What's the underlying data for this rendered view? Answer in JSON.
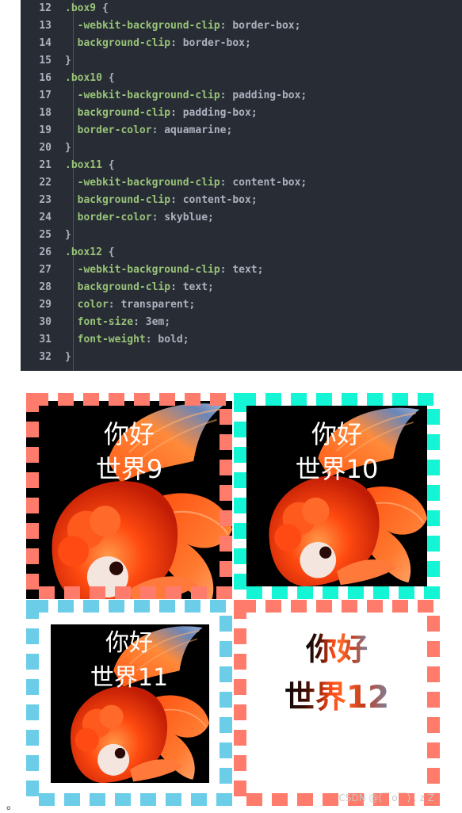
{
  "code": {
    "lines": [
      {
        "num": "12",
        "sel": ".box9",
        "rest": " {"
      },
      {
        "num": "13",
        "prop": "-webkit-background-clip",
        "val": "border-box"
      },
      {
        "num": "14",
        "prop": "background-clip",
        "val": "border-box"
      },
      {
        "num": "15",
        "close": "}"
      },
      {
        "num": "16",
        "sel": ".box10",
        "rest": " {"
      },
      {
        "num": "17",
        "prop": "-webkit-background-clip",
        "val": "padding-box"
      },
      {
        "num": "18",
        "prop": "background-clip",
        "val": "padding-box"
      },
      {
        "num": "19",
        "prop": "border-color",
        "val": "aquamarine"
      },
      {
        "num": "20",
        "close": "}"
      },
      {
        "num": "21",
        "sel": ".box11",
        "rest": " {"
      },
      {
        "num": "22",
        "prop": "-webkit-background-clip",
        "val": "content-box"
      },
      {
        "num": "23",
        "prop": "background-clip",
        "val": "content-box"
      },
      {
        "num": "24",
        "prop": "border-color",
        "val": "skyblue"
      },
      {
        "num": "25",
        "close": "}"
      },
      {
        "num": "26",
        "sel": ".box12",
        "rest": " {"
      },
      {
        "num": "27",
        "prop": "-webkit-background-clip",
        "val": "text"
      },
      {
        "num": "28",
        "prop": "background-clip",
        "val": "text"
      },
      {
        "num": "29",
        "prop": "color",
        "val": "transparent"
      },
      {
        "num": "30",
        "prop": "font-size",
        "val": "3em"
      },
      {
        "num": "31",
        "prop": "font-weight",
        "val": "bold"
      },
      {
        "num": "32",
        "close": "}"
      }
    ]
  },
  "boxes": {
    "box9": {
      "line1": "你好",
      "line2": "世界9"
    },
    "box10": {
      "line1": "你好",
      "line2": "世界10"
    },
    "box11": {
      "line1": "你好",
      "line2": "世界11"
    },
    "box12": {
      "line1": "你好",
      "line2": "世界12"
    }
  },
  "colors": {
    "salmon": "#ff7b6b",
    "aquamarine": "#14f5d6",
    "skyblue": "#6ccde8",
    "code_bg": "#282c34",
    "selector": "#98c379",
    "value": "#abb2bf"
  },
  "watermark": "CSDN @(￣o￣) . z Z",
  "stray_mark": "。"
}
